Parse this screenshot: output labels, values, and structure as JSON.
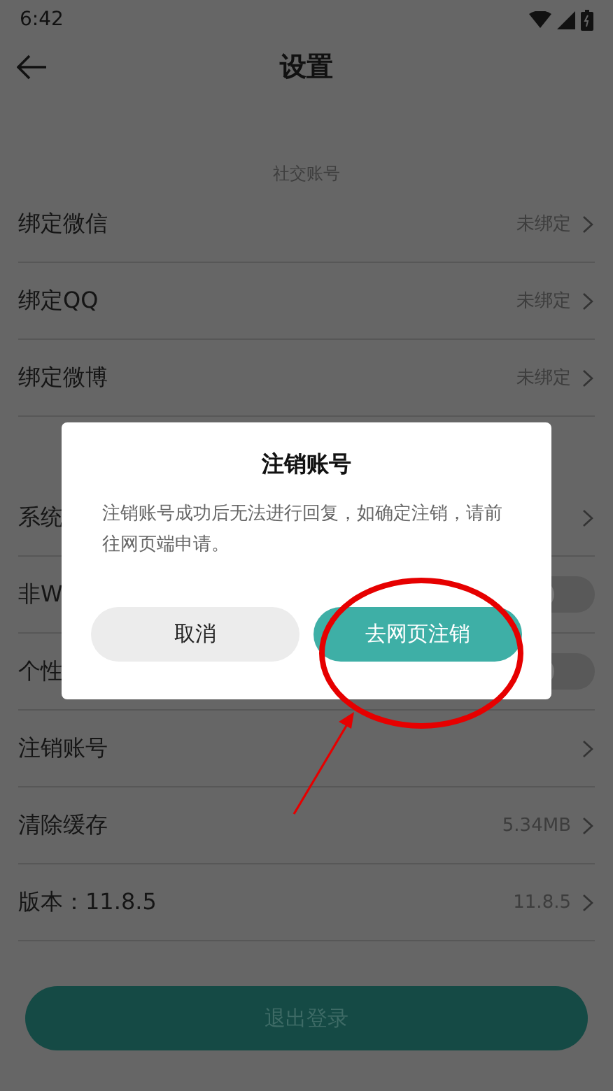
{
  "status_bar": {
    "time": "6:42"
  },
  "header": {
    "title": "设置"
  },
  "sections": [
    {
      "title": "社交账号",
      "rows": [
        {
          "kind": "link",
          "label": "绑定微信",
          "value": "未绑定"
        },
        {
          "kind": "link",
          "label": "绑定QQ",
          "value": "未绑定"
        },
        {
          "kind": "link",
          "label": "绑定微博",
          "value": "未绑定"
        }
      ]
    },
    {
      "rows": [
        {
          "kind": "link",
          "label": "系统"
        },
        {
          "kind": "toggle",
          "label": "非W",
          "on": false
        },
        {
          "kind": "toggle",
          "label": "个性",
          "on": false
        },
        {
          "kind": "link",
          "label": "注销账号"
        },
        {
          "kind": "link",
          "label": "清除缓存",
          "value": "5.34MB"
        },
        {
          "kind": "link",
          "label": "版本：11.8.5",
          "value": "11.8.5"
        }
      ]
    }
  ],
  "logout_button": "退出登录",
  "dialog": {
    "title": "注销账号",
    "message": "注销账号成功后无法进行回复，如确定注销，请前往网页端申请。",
    "buttons": [
      {
        "label": "取消",
        "kind": "secondary"
      },
      {
        "label": "去网页注销",
        "kind": "primary"
      }
    ]
  }
}
